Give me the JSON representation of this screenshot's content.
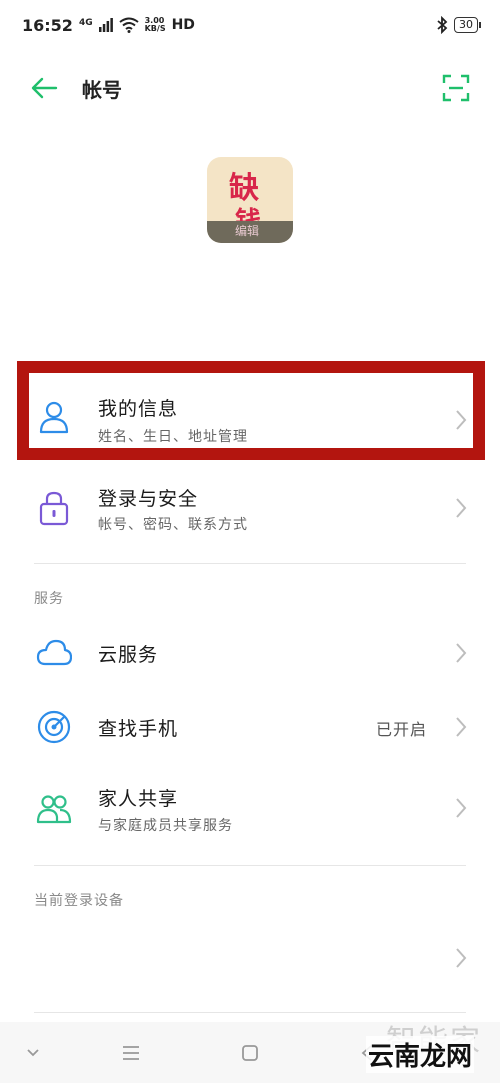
{
  "status_bar": {
    "time": "16:52",
    "network": "4G",
    "speed_value": "3.00",
    "speed_unit": "KB/S",
    "hd": "HD",
    "battery": "30"
  },
  "header": {
    "title": "帐号"
  },
  "avatar": {
    "char1": "缺",
    "char2": "钱",
    "tag": "编辑"
  },
  "rows": {
    "my_info": {
      "title": "我的信息",
      "subtitle": "姓名、生日、地址管理"
    },
    "login_security": {
      "title": "登录与安全",
      "subtitle": "帐号、密码、联系方式"
    },
    "cloud": {
      "title": "云服务"
    },
    "find_phone": {
      "title": "查找手机",
      "value": "已开启"
    },
    "family_share": {
      "title": "家人共享",
      "subtitle": "与家庭成员共享服务"
    }
  },
  "sections": {
    "services": "服务",
    "devices": "当前登录设备"
  },
  "watermark": {
    "line1": "智能家",
    "line2": "云南龙网"
  },
  "colors": {
    "accent_green": "#1fbf6b",
    "icon_blue": "#2d8ce8",
    "icon_purple": "#7a59d6",
    "icon_green": "#2fbf8a",
    "highlight_red": "#b3150f"
  }
}
